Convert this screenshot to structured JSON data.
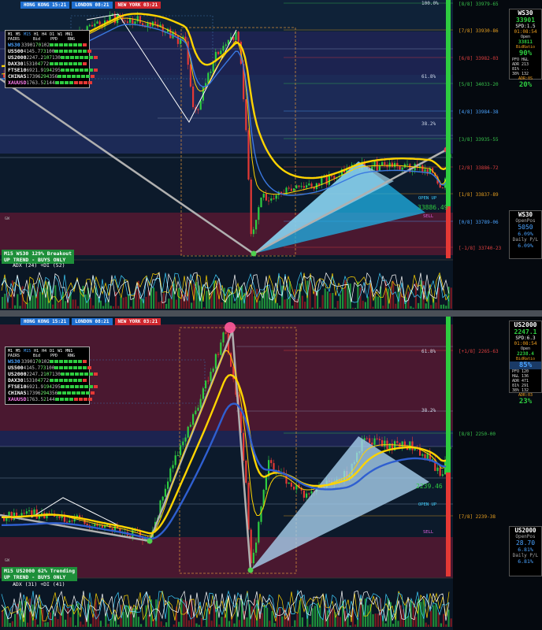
{
  "sessions": [
    {
      "label": "HONG KONG 15:21",
      "color": "#1f6fd0"
    },
    {
      "label": "LONDON 08:21",
      "color": "#1f6fd0"
    },
    {
      "label": "NEW YORK 03:21",
      "color": "#d0262e"
    }
  ],
  "scanner": {
    "timeframes": [
      "M1",
      "M5",
      "M15",
      "H1",
      "H4",
      "D1",
      "W1",
      "MN1"
    ],
    "col_headers": {
      "pairs": "PAIRS",
      "bid": "Bid",
      "pips": "PPD",
      "range": "RNG"
    },
    "rows": [
      {
        "sym": "WS30",
        "bid": "33901",
        "c1": "70",
        "c2": "102",
        "color": "#4aa3ff",
        "bars": [
          1,
          1,
          1,
          1,
          1,
          1,
          1,
          0
        ]
      },
      {
        "sym": "US500",
        "bid": "4145.7",
        "c1": "73",
        "c2": "100",
        "color": "#ffffff",
        "bars": [
          1,
          1,
          1,
          1,
          1,
          1,
          1,
          0
        ]
      },
      {
        "sym": "US2000",
        "bid": "2247.2",
        "c1": "107",
        "c2": "130",
        "color": "#ffffff",
        "bars": [
          1,
          1,
          1,
          1,
          1,
          1,
          1,
          0
        ]
      },
      {
        "sym": "DAX30",
        "bid": "15310",
        "c1": "47",
        "c2": "72",
        "color": "#ffffff",
        "bars": [
          1,
          1,
          1,
          1,
          1,
          1,
          1,
          0
        ]
      },
      {
        "sym": "FTSE10",
        "bid": "6921.9",
        "c1": "194",
        "c2": "295",
        "color": "#ffffff",
        "bars": [
          1,
          1,
          1,
          1,
          1,
          1,
          1,
          0
        ]
      },
      {
        "sym": "CHINA5",
        "bid": "17396",
        "c1": "294",
        "c2": "356",
        "color": "#ffffff",
        "bars": [
          1,
          1,
          1,
          1,
          1,
          1,
          1,
          0
        ]
      },
      {
        "sym": "XAUUSD",
        "bid": "1763.5",
        "c1": "2",
        "c2": "144",
        "color": "#ff7ff0",
        "bars": [
          1,
          1,
          1,
          1,
          0,
          0,
          0,
          0
        ]
      }
    ]
  },
  "chart1": {
    "instrument": "WS30",
    "price": "33901",
    "spread": "SPD:1.5",
    "timer": "01:08:54",
    "open_label": "Open",
    "open_value": "33811",
    "ratio_label": "BidRatio",
    "ratio_pct": "90%",
    "ratio_color": "#2ecc40",
    "mini_stats": [
      "PFO   H&L",
      "ADR   213",
      "81%   ...",
      "38%   132"
    ],
    "adr_label": "ADR:0S",
    "adr_pct": "20%",
    "fib_levels": [
      {
        "label": "[8/8]  33979-65",
        "color": "#37c24b"
      },
      {
        "label": "[7/8]  33930-86",
        "color": "#e8a020"
      },
      {
        "label": "[6/8]  33982-03",
        "color": "#e04040"
      },
      {
        "label": "[5/8]  34033-20",
        "color": "#37c24b"
      },
      {
        "label": "[4/8]  33984-38",
        "color": "#4aa3ff"
      },
      {
        "label": "[3/8]  33935-55",
        "color": "#37c24b"
      },
      {
        "label": "[2/8]  33886-72",
        "color": "#e04040"
      },
      {
        "label": "[1/8]  33837-89",
        "color": "#e8a020"
      },
      {
        "label": "[0/8]  33789-06",
        "color": "#4aa3ff"
      },
      {
        "label": "[-1/8] 33740-23",
        "color": "#e04040"
      }
    ],
    "fib_pct": [
      "100.0%",
      "61.8%",
      "38.2%"
    ],
    "open_up": "OPEN UP",
    "sell": "SELL",
    "current_price_tag": "33886.49",
    "bottom_box": {
      "sym": "WS30",
      "open_pos": "OpenPos",
      "open_pos_val": "5050",
      "open_pos_pct": "6.09%",
      "daily_pl": "Daily P/L",
      "daily_pl_pct": "6.09%"
    },
    "title": "M15 WS30 129% Breakout",
    "subtitle": "UP TREND - BUYS ONLY",
    "adx": "ADX (24)  +DI (52)",
    "gw": "GW"
  },
  "chart2": {
    "instrument": "US2000",
    "price": "2247.1",
    "spread": "SPD:6.3",
    "timer": "01:08:54",
    "open_label": "Open",
    "open_value": "2238.4",
    "ratio_label": "BidRatio",
    "ratio_pct": "85%",
    "ratio_color": "#4aa3ff",
    "mini_stats": [
      "PFO   120",
      "H&L   136",
      "ADR   471",
      "81%   291",
      "38%   132"
    ],
    "adr_label": "ADR:03",
    "adr_pct": "23%",
    "fib_levels": [
      {
        "label": "[+1/8]  2265-63",
        "color": "#e04040"
      },
      {
        "label": "[8/8]  2250-00",
        "color": "#37c24b"
      },
      {
        "label": "[7/8]  2239-38",
        "color": "#e8a020"
      }
    ],
    "fib_pct": [
      "61.8%",
      "38.2%"
    ],
    "open_up": "OPEN UP",
    "sell": "SELL",
    "current_price_tag": "2239.46",
    "bottom_box": {
      "sym": "US2000",
      "open_pos": "OpenPos",
      "open_pos_val": "28.70",
      "open_pos_pct": "6.81%",
      "daily_pl": "Daily P/L",
      "daily_pl_pct": "6.81%"
    },
    "title": "M15 US2000 62% Trending",
    "subtitle": "UP TREND - BUYS ONLY",
    "adx": "ADX (31)  +DI (41)",
    "gw": "GW"
  },
  "colors": {
    "bull": "#2ecc40",
    "bear": "#e53935",
    "bg": "#0c1a2b",
    "zone": "#4a1830",
    "ma_yellow": "#ffd400",
    "ma_blue": "#2f5fd0"
  }
}
